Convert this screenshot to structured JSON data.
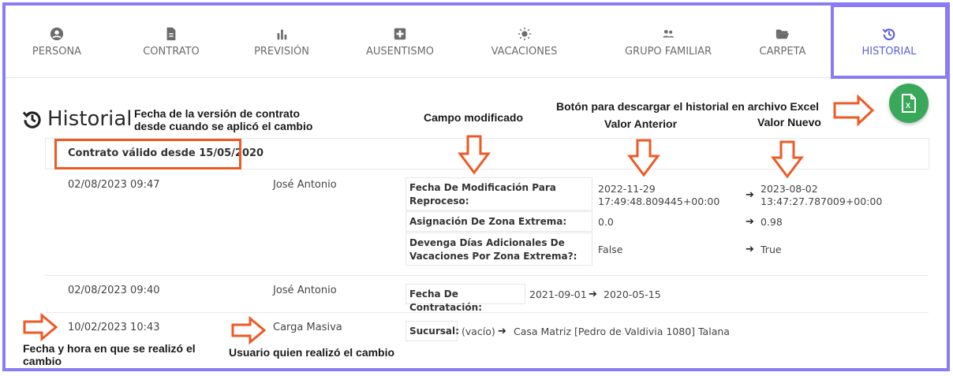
{
  "tabs": [
    {
      "label": "PERSONA",
      "icon": "person-circle-icon"
    },
    {
      "label": "CONTRATO",
      "icon": "document-icon"
    },
    {
      "label": "PREVISIÓN",
      "icon": "bar-chart-icon"
    },
    {
      "label": "AUSENTISMO",
      "icon": "medical-cross-icon"
    },
    {
      "label": "VACACIONES",
      "icon": "sun-icon"
    },
    {
      "label": "GRUPO FAMILIAR",
      "icon": "people-icon"
    },
    {
      "label": "CARPETA",
      "icon": "folder-open-icon"
    },
    {
      "label": "HISTORIAL",
      "icon": "history-icon"
    }
  ],
  "page": {
    "title": "Historial"
  },
  "annotations": {
    "fecha_version": "Fecha de la versión de contrato desde cuando se aplicó el cambio",
    "campo": "Campo modificado",
    "boton": "Botón para descargar el historial en archivo Excel",
    "valor_anterior": "Valor Anterior",
    "valor_nuevo": "Valor Nuevo",
    "fecha_hora": "Fecha y hora en que se realizó el cambio",
    "usuario": "Usuario quien realizó el cambio"
  },
  "contract_header": "Contrato válido desde 15/05/2020",
  "entries": [
    {
      "datetime": "02/08/2023 09:47",
      "user": "José Antonio",
      "changes": [
        {
          "field": "Fecha De Modificación Para Reproceso:",
          "old": "2022-11-29 17:49:48.809445+00:00",
          "new": "2023-08-02 13:47:27.787009+00:00"
        },
        {
          "field": "Asignación De Zona Extrema:",
          "old": "0.0",
          "new": "0.98"
        },
        {
          "field": "Devenga Días Adicionales De Vacaciones Por Zona Extrema?:",
          "old": "False",
          "new": "True"
        }
      ]
    },
    {
      "datetime": "02/08/2023 09:40",
      "user": "José Antonio",
      "changes": [
        {
          "field": "Fecha De Contratación:",
          "old": "2021-09-01",
          "new": "2020-05-15"
        }
      ]
    },
    {
      "datetime": "10/02/2023 10:43",
      "user": "Carga Masiva",
      "changes": [
        {
          "field": "Sucursal:",
          "old": "(vacío)",
          "new": "Casa Matriz [Pedro de Valdivia 1080] Talana"
        }
      ]
    }
  ],
  "colors": {
    "accent": "#5b5fe0",
    "frame": "#8b7cf6",
    "annotation_arrow": "#ee5a24",
    "excel_button": "#3aa85a"
  }
}
